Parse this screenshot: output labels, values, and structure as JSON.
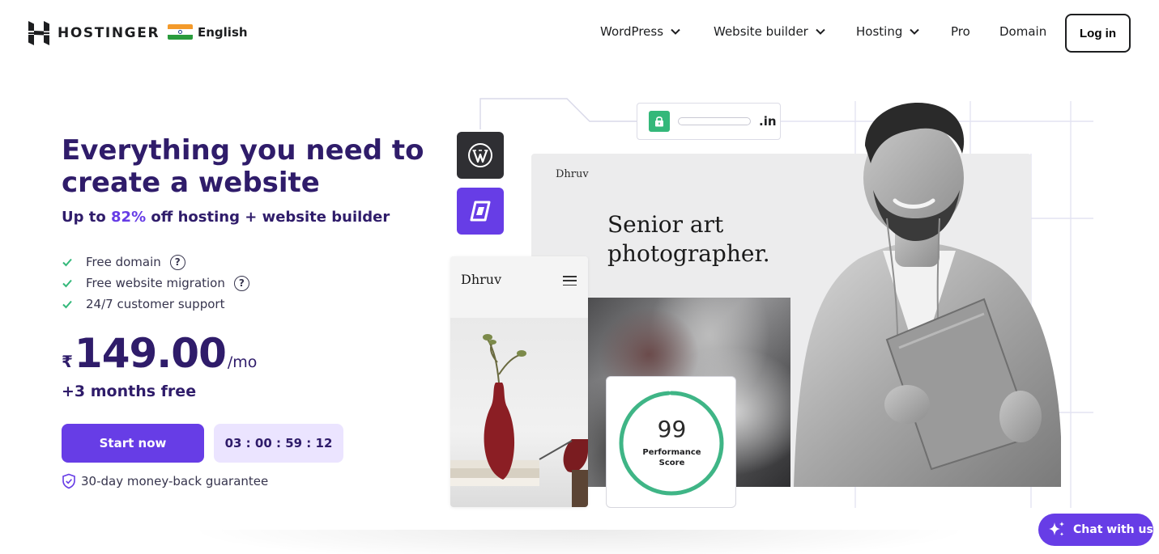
{
  "brand": {
    "name": "HOSTINGER"
  },
  "language": {
    "label": "English",
    "flag": "india-flag"
  },
  "nav": {
    "items": [
      {
        "label": "WordPress",
        "has_dropdown": true
      },
      {
        "label": "Website builder",
        "has_dropdown": true
      },
      {
        "label": "Hosting",
        "has_dropdown": true
      },
      {
        "label": "Pro",
        "has_dropdown": false
      },
      {
        "label": "Domain",
        "has_dropdown": false
      }
    ],
    "login_label": "Log in"
  },
  "hero": {
    "title": "Everything you need to create a website",
    "subtitle_prefix": "Up to ",
    "subtitle_discount": "82%",
    "subtitle_suffix": " off hosting + website builder",
    "features": [
      {
        "label": "Free domain",
        "has_help": true
      },
      {
        "label": "Free website migration",
        "has_help": true
      },
      {
        "label": "24/7 customer support",
        "has_help": false
      }
    ],
    "price": {
      "currency": "₹",
      "amount": "149.00",
      "period": "/mo"
    },
    "bonus": "+3 months free",
    "cta_label": "Start now",
    "timer": "03 : 00 : 59 : 12",
    "guarantee": "30-day money-back guarantee"
  },
  "illustration": {
    "domain_tld": ".in",
    "site_brand": "Dhruv",
    "mobile_brand": "Dhruv",
    "headline_line1": "Senior art",
    "headline_line2": "photographer.",
    "performance": {
      "score": "99",
      "label_line1": "Performance",
      "label_line2": "Score",
      "fraction": 0.99
    }
  },
  "chat": {
    "label": "Chat with us"
  },
  "colors": {
    "primary": "#673de6",
    "heading": "#2f1c6a",
    "success": "#34b87a",
    "timer_bg": "#ebe4ff"
  }
}
